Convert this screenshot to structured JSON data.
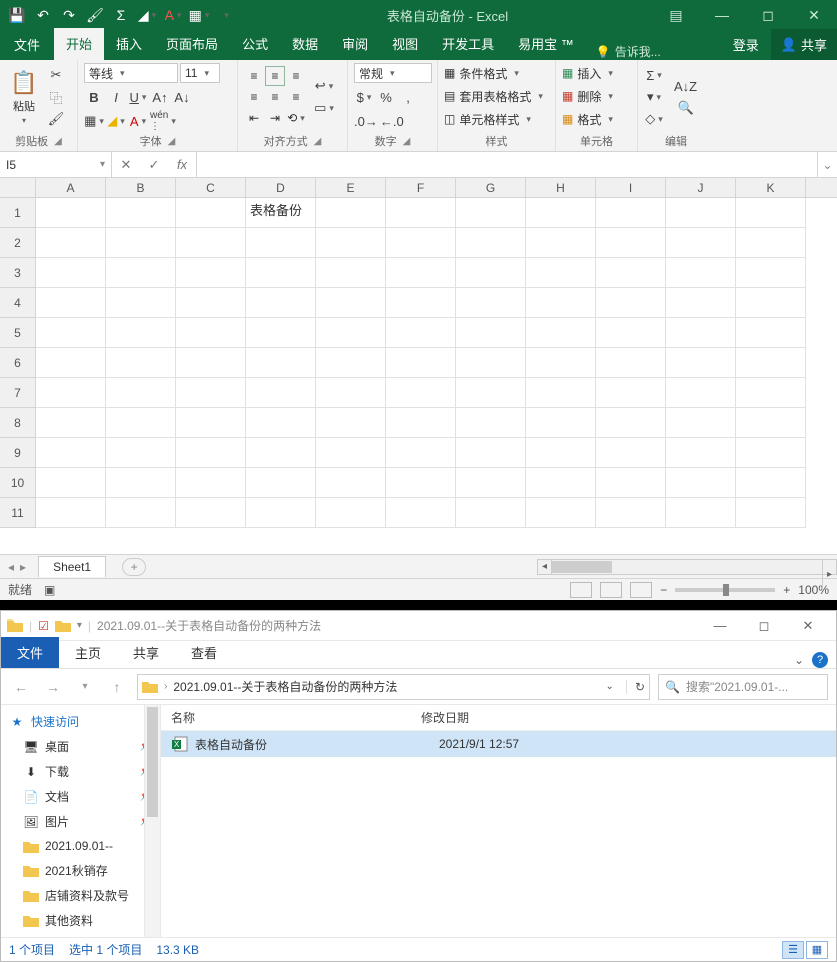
{
  "excel": {
    "title": "表格自动备份 - Excel",
    "tabs": {
      "file": "文件",
      "home": "开始",
      "insert": "插入",
      "layout": "页面布局",
      "formulas": "公式",
      "data": "数据",
      "review": "审阅",
      "view": "视图",
      "dev": "开发工具",
      "addin": "易用宝 ™"
    },
    "tellme": "告诉我...",
    "login": "登录",
    "share": "共享",
    "groups": {
      "clipboard": "剪贴板",
      "font": "字体",
      "align": "对齐方式",
      "number": "数字",
      "styles": "样式",
      "cells": "单元格",
      "editing": "编辑"
    },
    "paste": "粘贴",
    "fontName": "等线",
    "fontSize": "11",
    "numberFormat": "常规",
    "styleItems": {
      "cond": "条件格式",
      "table": "套用表格格式",
      "cell": "单元格样式"
    },
    "cellItems": {
      "insert": "插入",
      "delete": "删除",
      "format": "格式"
    },
    "nameBox": "I5",
    "columns": [
      "A",
      "B",
      "C",
      "D",
      "E",
      "F",
      "G",
      "H",
      "I",
      "J",
      "K"
    ],
    "rowCount": 11,
    "cellD1": "表格备份",
    "sheet": "Sheet1",
    "status": {
      "ready": "就绪",
      "zoom": "100%"
    }
  },
  "explorer": {
    "titlePath": "2021.09.01--关于表格自动备份的两种方法",
    "tabs": {
      "file": "文件",
      "home": "主页",
      "share": "共享",
      "view": "查看"
    },
    "breadcrumb": "2021.09.01--关于表格自动备份的两种方法",
    "searchPlaceholder": "搜索\"2021.09.01-...",
    "nav": {
      "quick": "快速访问",
      "items": [
        {
          "label": "桌面",
          "pin": true,
          "icon": "desktop"
        },
        {
          "label": "下载",
          "pin": true,
          "icon": "download"
        },
        {
          "label": "文档",
          "pin": true,
          "icon": "doc"
        },
        {
          "label": "图片",
          "pin": true,
          "icon": "pic"
        },
        {
          "label": "2021.09.01--",
          "pin": false,
          "icon": "folder"
        },
        {
          "label": "2021秋销存",
          "pin": false,
          "icon": "folder"
        },
        {
          "label": "店铺资料及款号",
          "pin": false,
          "icon": "folder"
        },
        {
          "label": "其他资料",
          "pin": false,
          "icon": "folder"
        }
      ]
    },
    "cols": {
      "name": "名称",
      "date": "修改日期"
    },
    "file": {
      "name": "表格自动备份",
      "date": "2021/9/1 12:57"
    },
    "status": {
      "count": "1 个项目",
      "sel": "选中 1 个项目",
      "size": "13.3 KB"
    }
  }
}
